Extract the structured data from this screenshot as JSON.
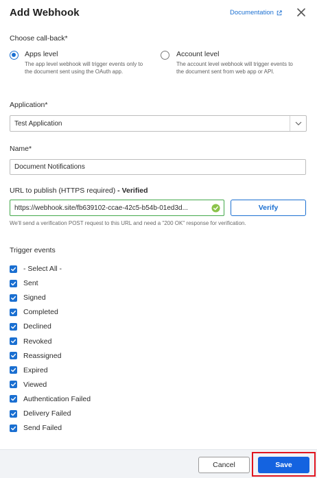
{
  "header": {
    "title": "Add Webhook",
    "documentation_label": "Documentation"
  },
  "callback": {
    "label": "Choose call-back*",
    "options": [
      {
        "title": "Apps level",
        "description": "The app level webhook will trigger events only to the document sent using the OAuth app.",
        "selected": true
      },
      {
        "title": "Account level",
        "description": "The account level webhook will trigger events to the document sent from web app or API.",
        "selected": false
      }
    ]
  },
  "application": {
    "label": "Application*",
    "value": "Test Application"
  },
  "name": {
    "label": "Name*",
    "value": "Document Notifications"
  },
  "url": {
    "label": "URL to publish (HTTPS required)",
    "status": "- Verified",
    "value": "https://webhook.site/fb639102-ccae-42c5-b54b-01ed3d...",
    "verify_label": "Verify",
    "hint": "We'll send a verification POST request to this URL and need a \"200 OK\" response for verification."
  },
  "trigger_events": {
    "label": "Trigger events",
    "items": [
      {
        "label": "- Select All -",
        "checked": true
      },
      {
        "label": "Sent",
        "checked": true
      },
      {
        "label": "Signed",
        "checked": true
      },
      {
        "label": "Completed",
        "checked": true
      },
      {
        "label": "Declined",
        "checked": true
      },
      {
        "label": "Revoked",
        "checked": true
      },
      {
        "label": "Reassigned",
        "checked": true
      },
      {
        "label": "Expired",
        "checked": true
      },
      {
        "label": "Viewed",
        "checked": true
      },
      {
        "label": "Authentication Failed",
        "checked": true
      },
      {
        "label": "Delivery Failed",
        "checked": true
      },
      {
        "label": "Send Failed",
        "checked": true
      }
    ]
  },
  "footer": {
    "cancel_label": "Cancel",
    "save_label": "Save"
  },
  "colors": {
    "accent": "#1a6fd1",
    "save_button": "#1463e0",
    "verified_border": "#42a84a",
    "highlight": "#e0141e"
  }
}
